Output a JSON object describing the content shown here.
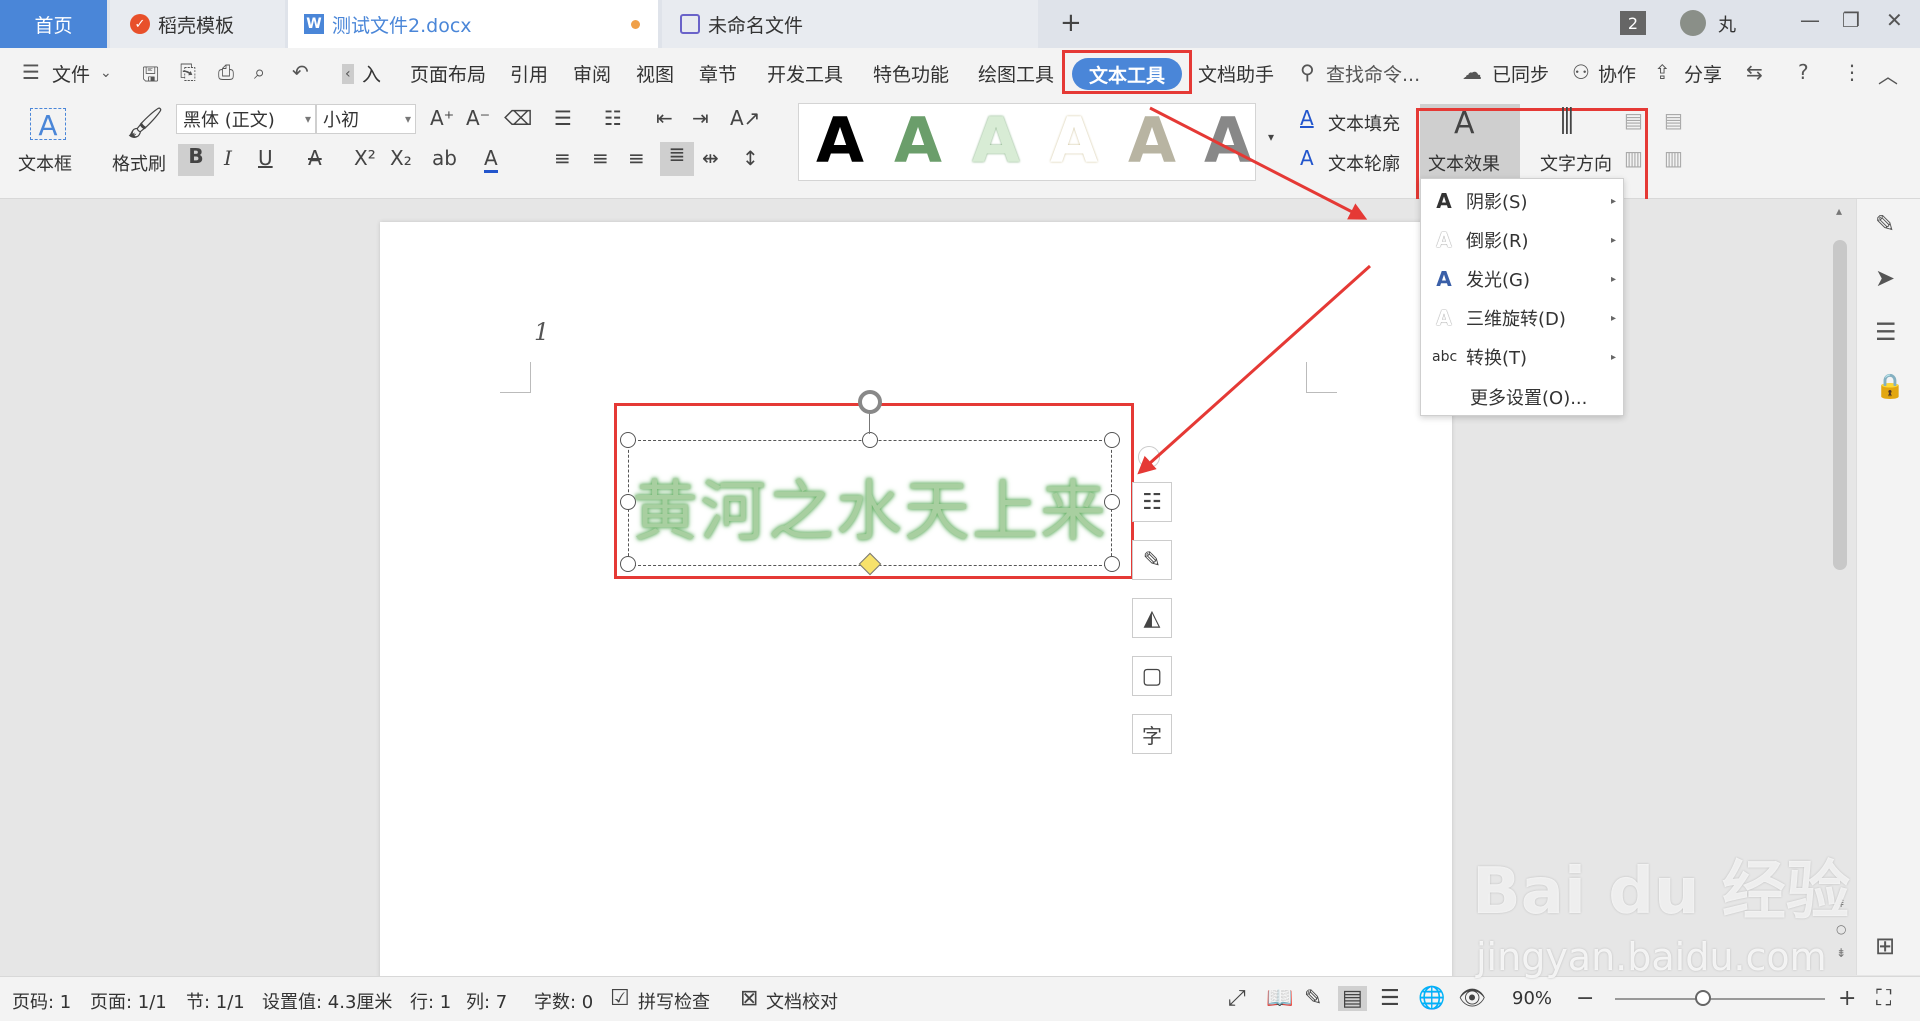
{
  "tabs": {
    "home": "首页",
    "daoke": "稻壳模板",
    "doc": "测试文件2.docx",
    "untitled": "未命名文件",
    "add": "+"
  },
  "window": {
    "badge": "2",
    "user": "丸",
    "minimize": "—",
    "restore": "❐",
    "close": "✕"
  },
  "menu": {
    "file": "文件",
    "insert_partial": "入",
    "items": [
      "页面布局",
      "引用",
      "审阅",
      "视图",
      "章节",
      "开发工具",
      "特色功能",
      "绘图工具",
      "文本工具",
      "文档助手"
    ],
    "search": "查找命令...",
    "synced": "已同步",
    "collab": "协作",
    "share": "分享"
  },
  "ribbon": {
    "textbox": "文本框",
    "format_painter": "格式刷",
    "font_name": "黑体 (正文)",
    "font_size": "小初",
    "text_fill": "文本填充",
    "text_outline": "文本轮廓",
    "text_effect": "文本效果",
    "text_direction": "文字方向",
    "gallery_letter": "A"
  },
  "dropdown": {
    "items": [
      {
        "icon": "A",
        "label": "阴影(S)",
        "sub": "▸"
      },
      {
        "icon": "A",
        "label": "倒影(R)",
        "sub": "▸"
      },
      {
        "icon": "A",
        "label": "发光(G)",
        "sub": "▸"
      },
      {
        "icon": "A",
        "label": "三维旋转(D)",
        "sub": "▸"
      },
      {
        "icon": "abc",
        "label": "转换(T)",
        "sub": "▸"
      }
    ],
    "more": "更多设置(O)..."
  },
  "document": {
    "page_number": "1",
    "art_text": "黄河之水天上来",
    "art_color": "#a8cfa0"
  },
  "status": {
    "page_code": "页码: 1",
    "pages": "页面: 1/1",
    "section": "节: 1/1",
    "setting": "设置值: 4.3厘米",
    "row": "行: 1",
    "col": "列: 7",
    "words": "字数: 0",
    "spell": "拼写检查",
    "proof": "文档校对",
    "zoom": "90%"
  },
  "watermark": {
    "main": "Bai du 经验",
    "sub": "jingyan.baidu.com"
  },
  "colors": {
    "accent": "#4a86d8",
    "highlight_red": "#e53935"
  }
}
